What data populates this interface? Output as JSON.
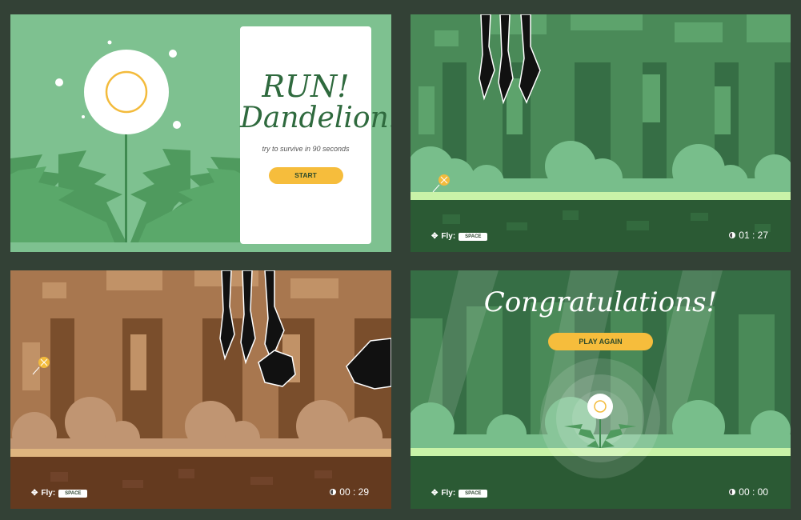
{
  "intro": {
    "title_line1": "RUN!",
    "title_line2": "Dandelion!",
    "subtitle": "try to survive in 90 seconds",
    "start_label": "START"
  },
  "hud": {
    "fly_label": "Fly:",
    "key_label": "SPACE",
    "move_icon": "move-arrows-icon",
    "clock_icon": "clock-icon"
  },
  "screens": [
    {
      "timer": "01 : 27"
    },
    {
      "timer": "00 : 29"
    },
    {
      "timer": "00 : 00"
    }
  ],
  "ending": {
    "congrats": "Congratulations!",
    "play_again_label": "PLAY AGAIN"
  },
  "colors": {
    "frame_bg": "#334136",
    "accent_yellow": "#f6bd3c",
    "forest_green": "#2e5f3a",
    "autumn_brown": "#6a4225",
    "ground_light": "#c9f3a8"
  }
}
